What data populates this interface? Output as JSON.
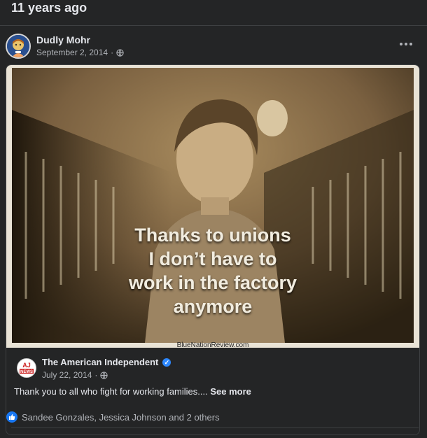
{
  "memory": {
    "title": "11 years ago"
  },
  "post": {
    "author": "Dudly Mohr",
    "date": "September 2, 2014",
    "separator": "·",
    "privacy_icon": "globe-icon",
    "more_icon": "more-options-icon"
  },
  "shared": {
    "image": {
      "caption_lines": [
        "Thanks to unions",
        "I don’t have to",
        "work in the factory",
        "anymore"
      ],
      "watermark": "BlueNationReview.com"
    },
    "source": {
      "author": "The American Independent",
      "avatar_text_top": "AJ",
      "avatar_text_bottom": "NEWS",
      "verified": true,
      "date": "July 22, 2014",
      "separator": "·",
      "text": "Thank you to all who fight for working families....",
      "see_more": "See more"
    }
  },
  "reactions": {
    "icon": "like-icon",
    "text": "Sandee Gonzales, Jessica Johnson and 2 others"
  },
  "colors": {
    "background": "#242526",
    "text": "#e4e6eb",
    "secondary": "#b0b3b8",
    "accent": "#1877f2"
  }
}
